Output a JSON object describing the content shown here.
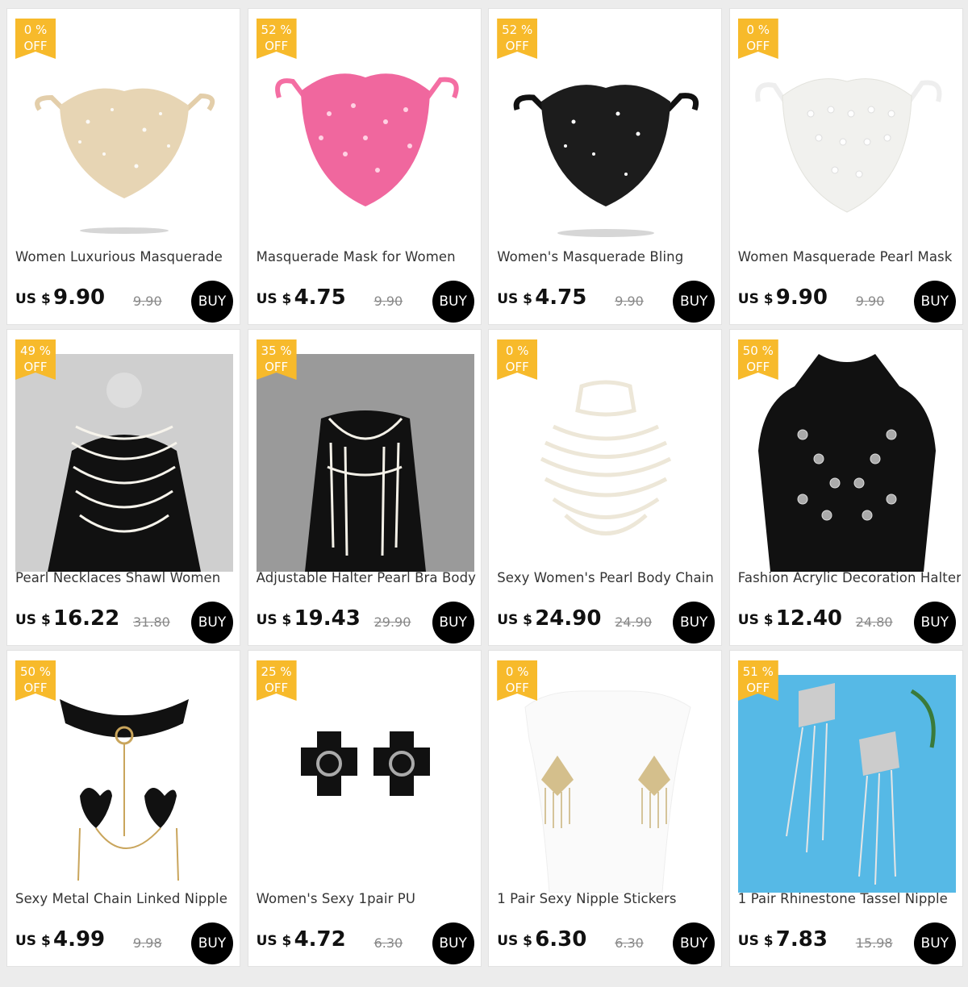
{
  "currency_label": "US $",
  "off_label": "OFF",
  "buy_label": "BUY",
  "products": [
    {
      "discount": "0 %",
      "title": "Women Luxurious Masquerade",
      "price": "9.90",
      "old_price": "9.90",
      "icon": "beige-rhinestone-mask-image",
      "color": "#e6d4b4"
    },
    {
      "discount": "52 %",
      "title": "Masquerade Mask for Women",
      "price": "4.75",
      "old_price": "9.90",
      "icon": "pink-rhinestone-mask-image",
      "color": "#f0679e"
    },
    {
      "discount": "52 %",
      "title": "Women's Masquerade Bling",
      "price": "4.75",
      "old_price": "9.90",
      "icon": "black-rhinestone-mask-image",
      "color": "#1c1c1c"
    },
    {
      "discount": "0 %",
      "title": "Women Masquerade Pearl Mask",
      "price": "9.90",
      "old_price": "9.90",
      "icon": "white-pearl-mask-image",
      "color": "#f1f1ee"
    },
    {
      "discount": "49 %",
      "title": "Pearl Necklaces Shawl Women",
      "price": "16.22",
      "old_price": "31.80",
      "icon": "pearl-shawl-model-image",
      "color": "#cfcfcf"
    },
    {
      "discount": "35 %",
      "title": "Adjustable Halter Pearl Bra Body",
      "price": "19.43",
      "old_price": "29.90",
      "icon": "pearl-bra-chain-model-image",
      "color": "#9a9a9a"
    },
    {
      "discount": "0 %",
      "title": "Sexy Women's Pearl Body Chain",
      "price": "24.90",
      "old_price": "24.90",
      "icon": "pearl-body-chain-image",
      "color": "#ffffff"
    },
    {
      "discount": "50 %",
      "title": "Fashion Acrylic Decoration Halter",
      "price": "12.40",
      "old_price": "24.80",
      "icon": "acrylic-halter-top-image",
      "color": "#ffffff"
    },
    {
      "discount": "50 %",
      "title": "Sexy Metal Chain Linked Nipple",
      "price": "4.99",
      "old_price": "9.98",
      "icon": "choker-chain-pasties-image",
      "color": "#ffffff"
    },
    {
      "discount": "25 %",
      "title": "Women's Sexy 1pair PU",
      "price": "4.72",
      "old_price": "6.30",
      "icon": "leather-cross-pasties-image",
      "color": "#ffffff"
    },
    {
      "discount": "0 %",
      "title": "1 Pair Sexy Nipple Stickers",
      "price": "6.30",
      "old_price": "6.30",
      "icon": "tassel-nipple-stickers-image",
      "color": "#ffffff"
    },
    {
      "discount": "51 %",
      "title": "1 Pair Rhinestone Tassel Nipple",
      "price": "7.83",
      "old_price": "15.98",
      "icon": "rhinestone-tassel-pasties-image",
      "color": "#56b9e6"
    }
  ]
}
